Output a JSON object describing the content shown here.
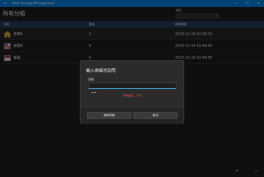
{
  "window": {
    "title": "New Storage Management",
    "back": "←",
    "minimize": "—",
    "maximize": "☐",
    "close": "✕"
  },
  "header": {
    "title": "所有分組"
  },
  "search": {
    "label": "搜索",
    "placeholder": "搜索",
    "icon": "search-icon"
  },
  "table": {
    "columns": [
      "分組",
      "數量",
      "創建時間"
    ],
    "rows": [
      {
        "name": "倉庫A",
        "count": "2",
        "created": "2023-12-19 22:50:13",
        "icon": "house-icon"
      },
      {
        "name": "房間A",
        "count": "0",
        "created": "2023-12-19 22:49:54",
        "icon": "room-icon"
      },
      {
        "name": "客廳",
        "count": "0",
        "created": "2023-12-19 22:49:35",
        "icon": "livingroom-icon"
      }
    ]
  },
  "dialog": {
    "title": "輸入密碼可訪問",
    "label": "密碼",
    "value": "•••",
    "error": "密碼錯誤，233",
    "clear_button": "刪除密碼",
    "cancel_button": "取消"
  },
  "bottom": {
    "add": "+",
    "remove": "—"
  },
  "colors": {
    "accent": "#0078d4",
    "table_header": "#213a57",
    "error": "#e04b4b",
    "focus": "#4cc2ff"
  }
}
